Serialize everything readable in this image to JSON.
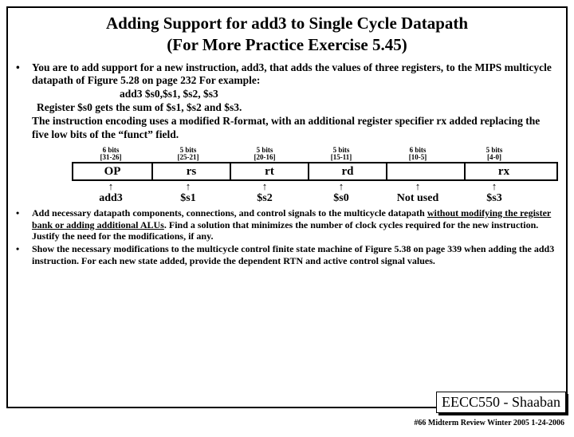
{
  "title_line1": "Adding Support for add3 to Single Cycle Datapath",
  "title_line2": "(For More Practice Exercise 5.45)",
  "bullet1": {
    "p1": "You are to add support for  a new instruction, add3,  that adds  the values of three registers, to the MIPS multicycle datapath of Figure 5.28 on page 232 For example:",
    "example": "add3   $s0,$s1, $s2, $s3",
    "p2": "Register $s0  gets the sum of  $s1, $s2 and $s3.",
    "p3": "The instruction encoding uses a modified R-format, with an additional register specifier  rx  added replacing the  five low bits of   the “funct” field."
  },
  "fields": [
    {
      "bits_top": "6 bits",
      "bits_bot": "[31-26]",
      "name": "OP",
      "arrow": "add3"
    },
    {
      "bits_top": "5 bits",
      "bits_bot": "[25-21]",
      "name": "rs",
      "arrow": "$s1"
    },
    {
      "bits_top": "5 bits",
      "bits_bot": "[20-16]",
      "name": "rt",
      "arrow": "$s2"
    },
    {
      "bits_top": "5 bits",
      "bits_bot": "[15-11]",
      "name": "rd",
      "arrow": "$s0"
    },
    {
      "bits_top": "6 bits",
      "bits_bot": "[10-5]",
      "name": "",
      "arrow": "Not used"
    },
    {
      "bits_top": "5 bits",
      "bits_bot": "[4-0]",
      "name": "rx",
      "arrow": "$s3"
    }
  ],
  "bullet2": "Add necessary datapath components, connections, and control signals to the multicycle datapath without modifying  the register bank or adding additional ALUs.   Find a solution that minimizes the number of clock cycles required for the new instruction.   Justify the need for the modifications, if any.",
  "bullet3": "Show the necessary modifications to the multicycle control finite state machine of Figure 5.38 on page 339 when adding the  add3 instruction.  For each new state added, provide the dependent RTN and active control signal values.",
  "course": "EECC550 - Shaaban",
  "footer": "#66   Midterm Review   Winter 2005 1-24-2006"
}
